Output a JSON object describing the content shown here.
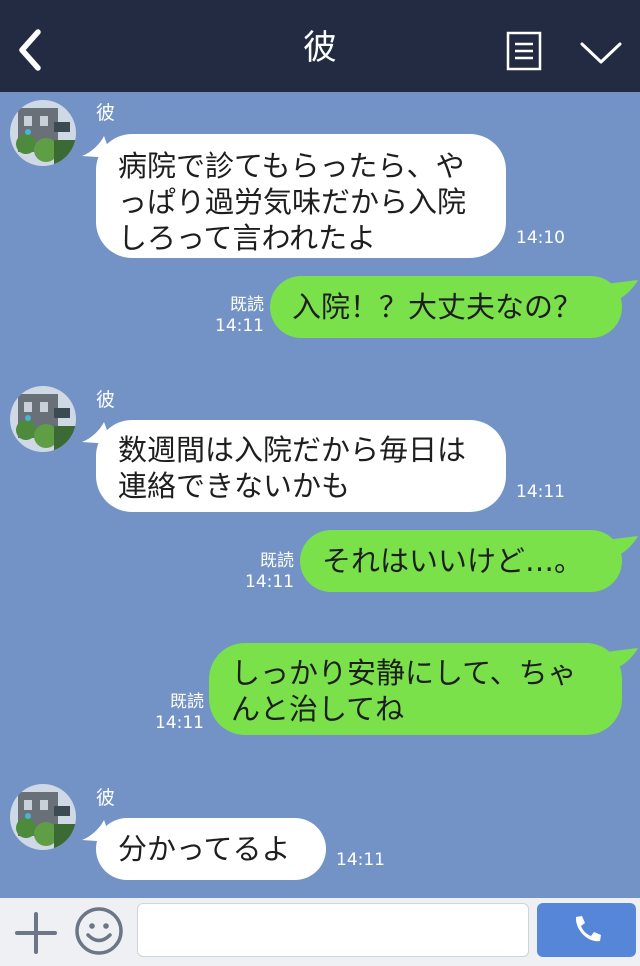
{
  "header": {
    "title": "彼",
    "back_icon": "chevron-left-icon",
    "menu_icon": "note-list-icon",
    "expand_icon": "chevron-down-icon"
  },
  "messages": [
    {
      "side": "left",
      "sender": "彼",
      "text": "病院で診てもらったら、や\nっぱり過労気味だから入院\nしろって言われたよ",
      "time": "14:10"
    },
    {
      "side": "right",
      "read": "既読",
      "text": "入院！？大丈夫なの？",
      "time": "14:11"
    },
    {
      "side": "left",
      "sender": "彼",
      "text": "数週間は入院だから毎日は\n連絡できないかも",
      "time": "14:11"
    },
    {
      "side": "right",
      "read": "既読",
      "text": "それはいいけど…。",
      "time": "14:11"
    },
    {
      "side": "right",
      "read": "既読",
      "text": "しっかり安静にして、ちゃ\nんと治してね",
      "time": "14:11"
    },
    {
      "side": "left",
      "sender": "彼",
      "text": "分かってるよ",
      "time": "14:11"
    }
  ],
  "footer": {
    "plus_icon": "plus-icon",
    "emoji_icon": "smiley-icon",
    "input_placeholder": "",
    "call_icon": "phone-icon"
  },
  "colors": {
    "header_bg": "#232b42",
    "chat_bg": "#7393c6",
    "left_bubble": "#ffffff",
    "right_bubble": "#7ae14b",
    "call_button": "#5586d8"
  }
}
